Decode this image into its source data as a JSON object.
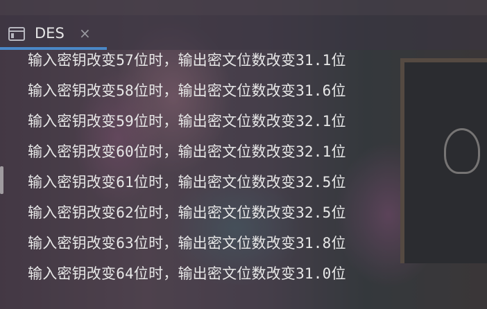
{
  "tab": {
    "title": "DES",
    "icon": "console-window-icon",
    "close_glyph": "×",
    "accent_color": "#4a88c7"
  },
  "console": {
    "text_color": "#e8e8e8",
    "lines": [
      "输入密钥改变57位时，输出密文位数改变31.1位",
      "输入密钥改变58位时，输出密文位数改变31.6位",
      "输入密钥改变59位时，输出密文位数改变32.1位",
      "输入密钥改变60位时，输出密文位数改变32.1位",
      "输入密钥改变61位时，输出密文位数改变32.5位",
      "输入密钥改变62位时，输出密文位数改变32.5位",
      "输入密钥改变63位时，输出密文位数改变31.8位",
      "输入密钥改变64位时，输出密文位数改变31.0位"
    ]
  }
}
